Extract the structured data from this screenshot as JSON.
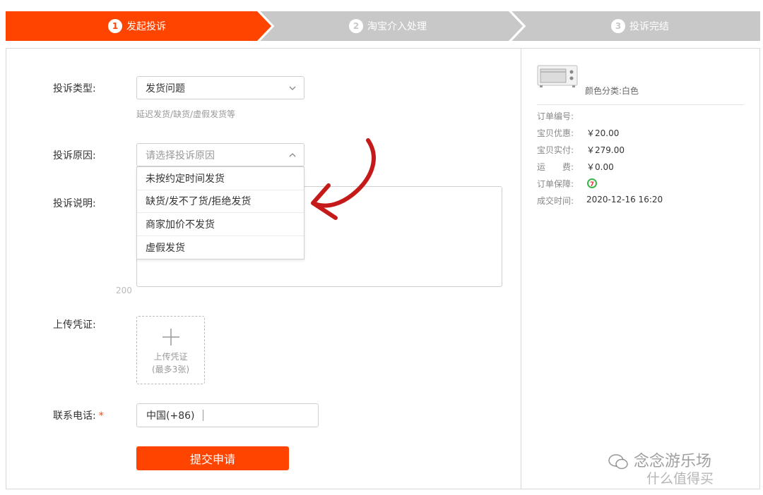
{
  "steps": [
    {
      "num": "1",
      "label": "发起投诉"
    },
    {
      "num": "2",
      "label": "淘宝介入处理"
    },
    {
      "num": "3",
      "label": "投诉完结"
    }
  ],
  "colors": {
    "accent": "#ff4400",
    "step_inactive": "#c8c8c8"
  },
  "form": {
    "type_label": "投诉类型:",
    "type_value": "发货问题",
    "type_hint": "延迟发货/缺货/虚假发货等",
    "reason_label": "投诉原因:",
    "reason_placeholder": "请选择投诉原因",
    "reason_options": [
      "未按约定时间发货",
      "缺货/发不了货/拒绝发货",
      "商家加价不发货",
      "虚假发货"
    ],
    "desc_label": "投诉说明:",
    "desc_counter": "200",
    "upload_label": "上传凭证:",
    "upload_text": "上传凭证",
    "upload_subtext": "(最多3张)",
    "phone_label": "联系电话:",
    "phone_required_mark": "*",
    "phone_prefix": "中国(+86)",
    "submit_label": "提交申请"
  },
  "order": {
    "color_category": "颜色分类:白色",
    "rows": [
      {
        "key": "订单编号:",
        "value": ""
      },
      {
        "key": "宝贝优惠:",
        "value": "￥20.00"
      },
      {
        "key": "宝贝实付:",
        "value": "￥279.00"
      },
      {
        "key": "运　　费:",
        "value": "￥0.00"
      },
      {
        "key": "订单保障:",
        "value": ""
      },
      {
        "key": "成交时间:",
        "value": "2020-12-16 16:20"
      }
    ],
    "guarantee_icon": "seven-day-return-icon",
    "product_icon": "oven-thumbnail"
  },
  "watermark": {
    "line1": "念念游乐场",
    "line2": "什么值得买"
  }
}
